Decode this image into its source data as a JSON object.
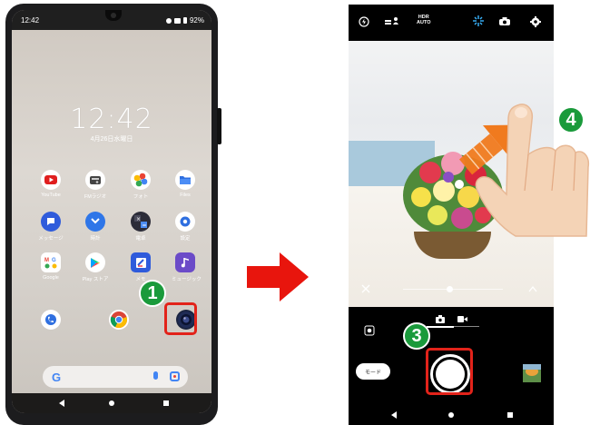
{
  "left_phone": {
    "status_time": "12:42",
    "battery": "92%",
    "clock": "12:42",
    "date": "4月26日水曜日",
    "apps": [
      {
        "label": "YouTube",
        "icon": "youtube-icon",
        "color": "#ffffff"
      },
      {
        "label": "FMラジオ",
        "icon": "fm-radio-icon",
        "color": "#ffffff"
      },
      {
        "label": "フォト",
        "icon": "photos-icon",
        "color": "#ffffff"
      },
      {
        "label": "Files",
        "icon": "files-icon",
        "color": "#ffffff"
      },
      {
        "label": "メッセージ",
        "icon": "messages-icon",
        "color": "#2f5bdb"
      },
      {
        "label": "時計",
        "icon": "clock-icon",
        "color": "#2f76e8"
      },
      {
        "label": "電卓",
        "icon": "calculator-icon",
        "color": "#2c2c38"
      },
      {
        "label": "設定",
        "icon": "settings-icon",
        "color": "#ffffff"
      },
      {
        "label": "Google",
        "icon": "google-folder-icon",
        "color": "#ffffff"
      },
      {
        "label": "Play ストア",
        "icon": "play-store-icon",
        "color": "#ffffff"
      },
      {
        "label": "メモ",
        "icon": "notes-icon",
        "color": "#2f5bdb"
      },
      {
        "label": "ミュージック",
        "icon": "music-icon",
        "color": "#6b4bc8"
      }
    ],
    "dock": [
      {
        "label": "",
        "icon": "phone-icon"
      },
      {
        "label": "",
        "icon": "chrome-icon"
      },
      {
        "label": "",
        "icon": "camera-icon"
      }
    ]
  },
  "steps": {
    "one": "1",
    "three": "3",
    "four": "4"
  },
  "right_phone": {
    "hdr_line1": "HDR",
    "hdr_line2": "AUTO",
    "mode_button": "モード"
  },
  "colors": {
    "highlight_red": "#e2231a",
    "step_green": "#1a9a3b",
    "arrow_red": "#e8150d",
    "swipe_orange": "#f07a1e"
  }
}
